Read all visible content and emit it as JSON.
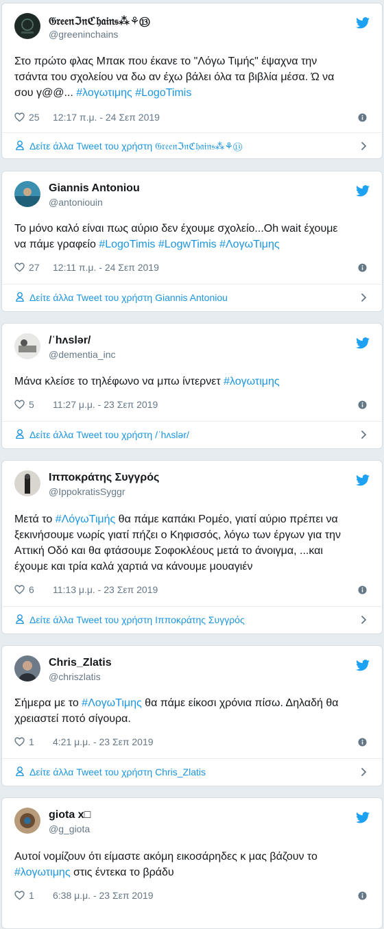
{
  "colors": {
    "link": "#1b95e0",
    "secondary": "#657786",
    "twitter_blue": "#1da1f2",
    "background": "#e6ecf0"
  },
  "icons": [
    "twitter-bird-icon",
    "heart-icon",
    "info-icon",
    "person-icon",
    "chevron-right-icon"
  ],
  "tweets": [
    {
      "name": "𝔊𝔯𝔢𝔢𝔫ℑ𝔫ℭ𝔥𝔞𝔦𝔫𝔰⁂⚘⑬",
      "handle": "@greeninchains",
      "text_lines": [
        [
          {
            "t": "Στο πρώτο φλας Μπακ που έκανε το \"Λόγω Τιμής\" έψαχνα την"
          }
        ],
        [
          {
            "t": "τσάντα του σχολείου να δω αν έχω βάλει όλα τα βιβλία μέσα. Ώ να"
          }
        ],
        [
          {
            "t": "σου γ@@... "
          },
          {
            "t": "#λογωτιμης",
            "tag": true
          },
          {
            "t": " "
          },
          {
            "t": "#LogoTimis",
            "tag": true
          }
        ]
      ],
      "likes": "25",
      "time": "12:17 π.μ. - 24 Σεπ 2019",
      "more": "Δείτε άλλα Tweet του χρήστη 𝔊𝔯𝔢𝔢𝔫ℑ𝔫ℭ𝔥𝔞𝔦𝔫𝔰⁂⚘⑬"
    },
    {
      "name": "Giannis Antoniou",
      "handle": "@antoniouin",
      "text_lines": [
        [
          {
            "t": "Το μόνο καλό είναι πως αύριο δεν έχουμε σχολείο...Oh wait έχουμε"
          }
        ],
        [
          {
            "t": "να πάμε γραφείο "
          },
          {
            "t": "#LogoTimis",
            "tag": true
          },
          {
            "t": " "
          },
          {
            "t": "#LogwTimis",
            "tag": true
          },
          {
            "t": " "
          },
          {
            "t": "#ΛογωΤιμης",
            "tag": true
          }
        ]
      ],
      "likes": "27",
      "time": "12:11 π.μ. - 24 Σεπ 2019",
      "more": "Δείτε άλλα Tweet του χρήστη Giannis Antoniou"
    },
    {
      "name": "/ˈhʌslər/",
      "handle": "@dementia_inc",
      "text_lines": [
        [
          {
            "t": "Μάνα κλείσε το τηλέφωνο να μπω ίντερνετ "
          },
          {
            "t": "#λογωτιμης",
            "tag": true
          }
        ]
      ],
      "likes": "5",
      "time": "11:27 μ.μ. - 23 Σεπ 2019",
      "more": "Δείτε άλλα Tweet του χρήστη /ˈhʌslər/"
    },
    {
      "name": "Ιπποκράτης Συγγρός",
      "handle": "@IppokratisSyggr",
      "text_lines": [
        [
          {
            "t": "Μετά το "
          },
          {
            "t": "#ΛόγωΤιμής",
            "tag": true
          },
          {
            "t": " θα πάμε καπάκι Ρομέο, γιατί αύριο πρέπει να"
          }
        ],
        [
          {
            "t": "ξεκινήσουμε νωρίς γιατί πήζει ο Κηφισσός, λόγω των έργων για την"
          }
        ],
        [
          {
            "t": "Αττική Οδό και θα φτάσουμε Σοφοκλέους μετά το άνοιγμα, ...και"
          }
        ],
        [
          {
            "t": "έχουμε και τρία καλά χαρτιά να κάνουμε μουαγιέν"
          }
        ]
      ],
      "likes": "6",
      "time": "11:13 μ.μ. - 23 Σεπ 2019",
      "more": "Δείτε άλλα Tweet του χρήστη Ιπποκράτης Συγγρός"
    },
    {
      "name": "Chris_Zlatis",
      "handle": "@chriszlatis",
      "text_lines": [
        [
          {
            "t": "Σήμερα με το "
          },
          {
            "t": "#ΛογωΤιμης",
            "tag": true
          },
          {
            "t": " θα πάμε είκοσι χρόνια πίσω. Δηλαδή θα"
          }
        ],
        [
          {
            "t": "χρειαστεί ποτό σίγουρα."
          }
        ]
      ],
      "likes": "1",
      "time": "4:21 μ.μ. - 23 Σεπ 2019",
      "more": "Δείτε άλλα Tweet του χρήστη Chris_Zlatis"
    },
    {
      "name": "giota x□",
      "handle": "@g_giota",
      "text_lines": [
        [
          {
            "t": "Αυτοί νομίζουν ότι είμαστε ακόμη εικοσάρηδες κ μας βάζουν το"
          }
        ],
        [
          {
            "t": "#λογωτιμης",
            "tag": true
          },
          {
            "t": " στις έντεκα το βράδυ"
          }
        ]
      ],
      "likes": "1",
      "time": "6:38 μ.μ. - 23 Σεπ 2019"
    }
  ]
}
